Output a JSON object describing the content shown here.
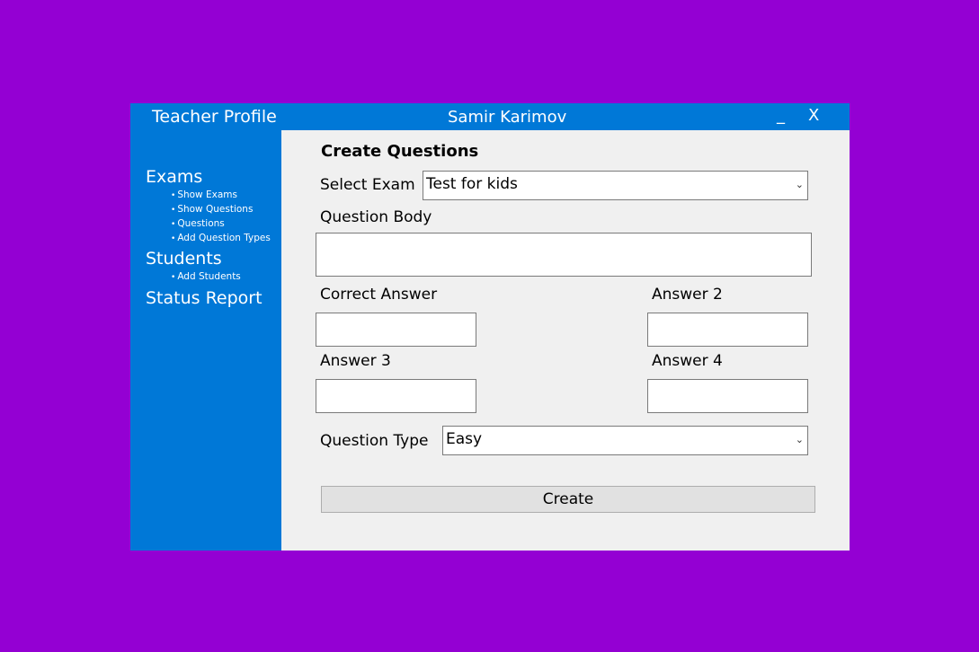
{
  "window": {
    "title_left": "Teacher Profile",
    "user_name": "Samir Karimov",
    "minimize_label": "_",
    "close_label": "X"
  },
  "sidebar": {
    "exams": {
      "label": "Exams",
      "items": [
        {
          "label": "Show Exams"
        },
        {
          "label": "Show Questions"
        },
        {
          "label": "Questions"
        },
        {
          "label": "Add Question Types"
        }
      ]
    },
    "students": {
      "label": "Students",
      "items": [
        {
          "label": "Add Students"
        }
      ]
    },
    "status_report": {
      "label": "Status Report"
    },
    "bullet_glyph": "•"
  },
  "form": {
    "title": "Create Questions",
    "select_exam_label": "Select Exam",
    "select_exam_value": "Test for kids",
    "question_body_label": "Question Body",
    "question_body_value": "",
    "correct_answer_label": "Correct Answer",
    "correct_answer_value": "",
    "answer2_label": "Answer 2",
    "answer2_value": "",
    "answer3_label": "Answer 3",
    "answer3_value": "",
    "answer4_label": "Answer 4",
    "answer4_value": "",
    "question_type_label": "Question Type",
    "question_type_value": "Easy",
    "create_button_label": "Create",
    "chevron_icon": "chevron-down-icon"
  },
  "colors": {
    "background": "#9400D3",
    "accent": "#0078D7",
    "panel": "#F0F0F0",
    "button": "#E1E1E1"
  }
}
